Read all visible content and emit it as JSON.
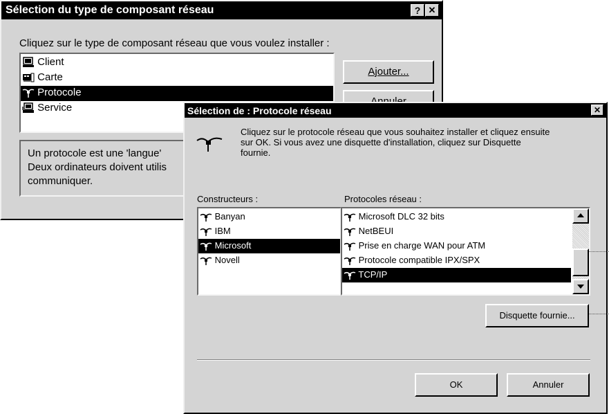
{
  "back": {
    "title": "Sélection du type de composant réseau",
    "help_label": "?",
    "close_label": "✕",
    "prompt": "Cliquez sur le type de composant réseau que vous voulez installer :",
    "items": [
      {
        "label": "Client",
        "icon": "computer-icon"
      },
      {
        "label": "Carte",
        "icon": "network-card-icon"
      },
      {
        "label": "Protocole",
        "icon": "protocol-plug-icon"
      },
      {
        "label": "Service",
        "icon": "service-computer-icon"
      }
    ],
    "selected_index": 2,
    "add_label": "Ajouter...",
    "cancel_label": "Annuler",
    "description": "Un protocole est une 'langue' ... Deux ordinateurs doivent utilis... communiquer.",
    "desc_lines": [
      "Un protocole est une 'langue'",
      "Deux ordinateurs doivent utilis",
      "communiquer."
    ]
  },
  "front": {
    "title": "Sélection de : Protocole réseau",
    "close_label": "✕",
    "instructions_lines": [
      "Cliquez sur le protocole réseau que vous souhaitez installer et cliquez ensuite",
      "sur OK. Si vous avez une disquette d'installation, cliquez sur Disquette",
      "fournie."
    ],
    "manufacturers_label": "Constructeurs :",
    "protocols_label": "Protocoles réseau :",
    "manufacturers": [
      "Banyan",
      "IBM",
      "Microsoft",
      "Novell"
    ],
    "manufacturer_selected": 2,
    "protocols": [
      "Microsoft DLC 32 bits",
      "NetBEUI",
      "Prise en charge WAN pour ATM",
      "Protocole compatible IPX/SPX",
      "TCP/IP"
    ],
    "protocol_selected": 4,
    "disk_label": "Disquette fournie...",
    "ok_label": "OK",
    "cancel_label": "Annuler"
  },
  "colors": {
    "titlebar": "#000000",
    "face": "#d4d4d4",
    "selection": "#000000"
  }
}
